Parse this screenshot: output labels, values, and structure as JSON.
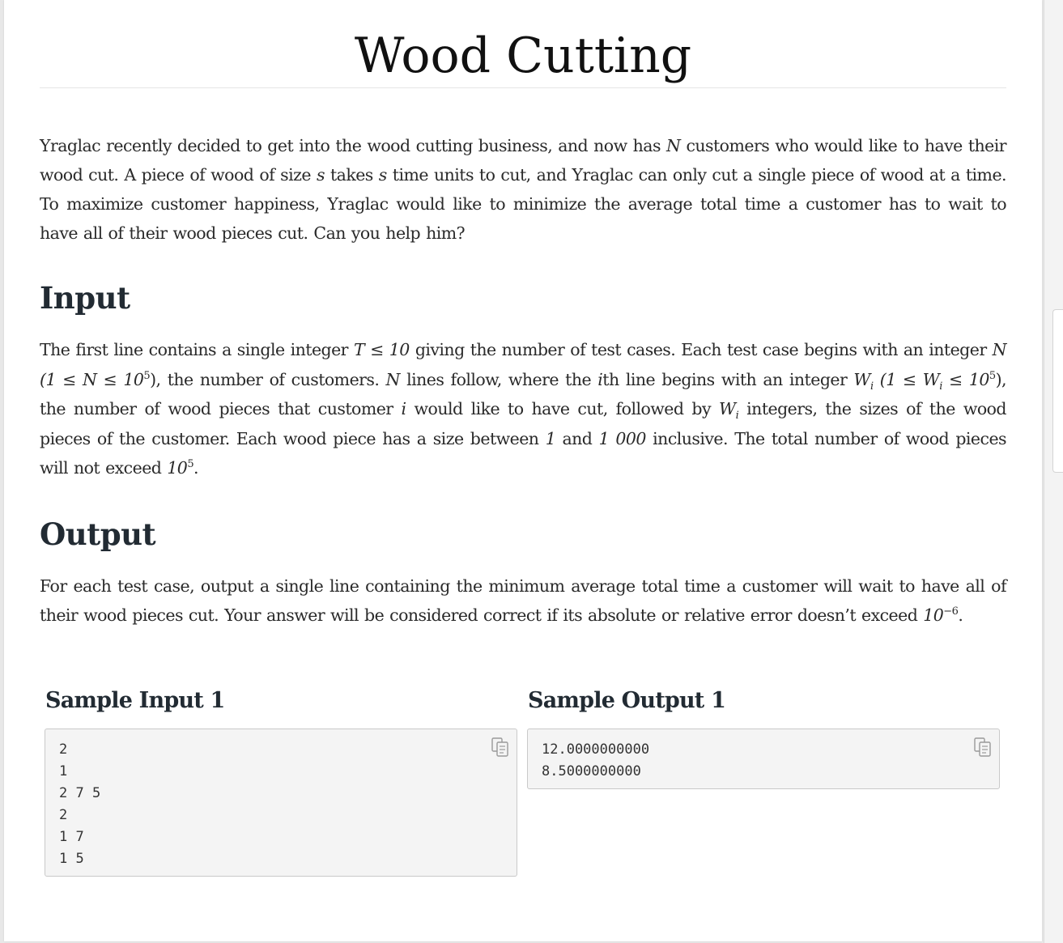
{
  "title": "Wood Cutting",
  "intro": {
    "t1": "Yraglac recently decided to get into the wood cutting business, and now has ",
    "v_N": "N",
    "t2": " customers who would like to have their wood cut. A piece of wood of size ",
    "v_s1": "s",
    "t3": " takes ",
    "v_s2": "s",
    "t4": " time units to cut, and Yraglac can only cut a single piece of wood at a time. To maximize customer happiness, Yraglac would like to minimize the average total time a customer has to wait to have all of their wood pieces cut. Can you help him?"
  },
  "input_section": {
    "heading": "Input",
    "t1": "The first line contains a single integer ",
    "m1": "T ≤ 10",
    "t2": " giving the number of test cases. Each test case begins with an integer ",
    "m2": "N",
    "m3": " (1 ≤ N ≤ 10",
    "m3_sup": "5",
    "t3": "), the number of customers. ",
    "m4": "N",
    "t4": " lines follow, where the ",
    "m5": "i",
    "t5": "th line begins with an integer ",
    "m6": "W",
    "m6_sub": "i",
    "m7": " (1 ≤ W",
    "m7_sub": "i",
    "m7b": " ≤ 10",
    "m7_sup": "5",
    "t6": "), the number of wood pieces that customer ",
    "m8": "i",
    "t7": " would like to have cut, followed by ",
    "m9": "W",
    "m9_sub": "i",
    "t8": " integers, the sizes of the wood pieces of the customer. Each wood piece has a size between ",
    "m10": "1",
    "t9": " and ",
    "m11": "1 000",
    "t10": " inclusive. The total number of wood pieces will not exceed ",
    "m12": "10",
    "m12_sup": "5",
    "t11": "."
  },
  "output_section": {
    "heading": "Output",
    "t1": "For each test case, output a single line containing the minimum average total time a customer will wait to have all of their wood pieces cut. Your answer will be considered correct if its absolute or relative error doesn’t exceed ",
    "m1": "10",
    "m1_sup": "−6",
    "t2": "."
  },
  "sample_input": {
    "title": "Sample Input 1",
    "lines": [
      "2",
      "1",
      "2 7 5",
      "2",
      "1 7",
      "1 5"
    ]
  },
  "sample_output": {
    "title": "Sample Output 1",
    "lines": [
      "12.0000000000",
      "8.5000000000"
    ]
  },
  "icons": {
    "copy": "copy-icon"
  }
}
